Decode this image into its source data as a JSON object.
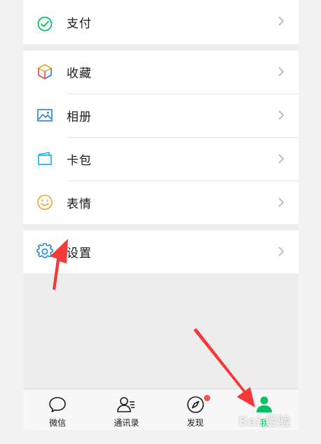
{
  "menu": {
    "pay": "支付",
    "favorites": "收藏",
    "album": "相册",
    "cards": "卡包",
    "stickers": "表情",
    "settings": "设置"
  },
  "tabbar": {
    "chats": "微信",
    "contacts": "通讯录",
    "discover": "发现",
    "me": "我"
  },
  "watermark": "Bai 经验",
  "colors": {
    "accent": "#07c160",
    "badge": "#fa5151",
    "arrow": "#f23a3a"
  }
}
